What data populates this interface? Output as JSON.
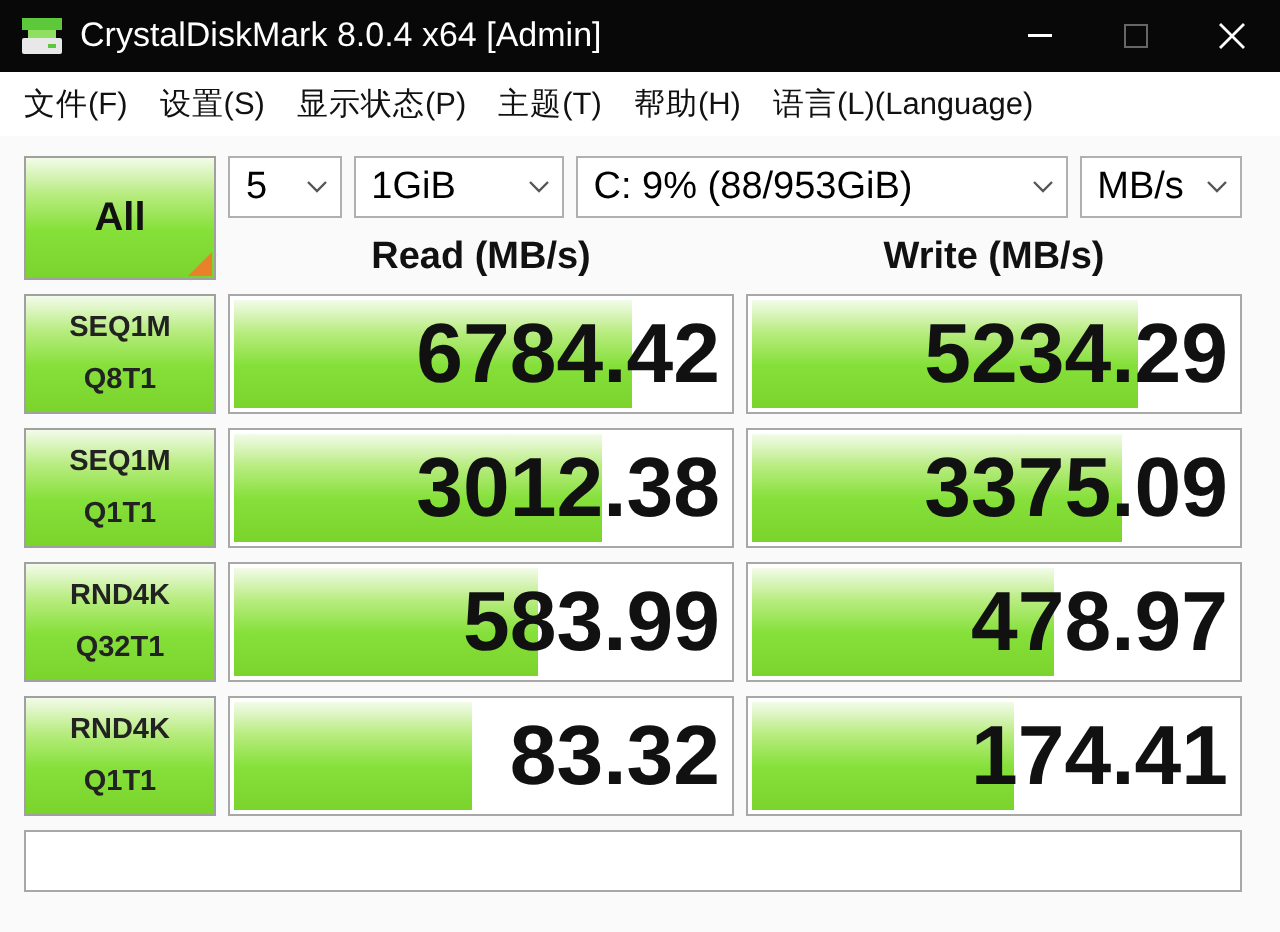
{
  "window": {
    "title": "CrystalDiskMark 8.0.4 x64 [Admin]"
  },
  "menu": [
    "文件(F)",
    "设置(S)",
    "显示状态(P)",
    "主题(T)",
    "帮助(H)",
    "语言(L)(Language)"
  ],
  "all_button": "All",
  "selectors": [
    {
      "kind": "count",
      "value": "5"
    },
    {
      "kind": "size",
      "value": "1GiB"
    },
    {
      "kind": "drive",
      "value": "C: 9% (88/953GiB)"
    },
    {
      "kind": "unit",
      "value": "MB/s"
    }
  ],
  "headers": {
    "read": "Read (MB/s)",
    "write": "Write (MB/s)"
  },
  "tests": [
    {
      "label": [
        "SEQ1M",
        "Q8T1"
      ],
      "read": {
        "value": "6784.42",
        "level": 0.81
      },
      "write": {
        "value": "5234.29",
        "level": 0.8
      }
    },
    {
      "label": [
        "SEQ1M",
        "Q1T1"
      ],
      "read": {
        "value": "3012.38",
        "level": 0.75
      },
      "write": {
        "value": "3375.09",
        "level": 0.77
      }
    },
    {
      "label": [
        "RND4K",
        "Q32T1"
      ],
      "read": {
        "value": "583.99",
        "level": 0.62
      },
      "write": {
        "value": "478.97",
        "level": 0.63
      }
    },
    {
      "label": [
        "RND4K",
        "Q1T1"
      ],
      "read": {
        "value": "83.32",
        "level": 0.49
      },
      "write": {
        "value": "174.41",
        "level": 0.55
      }
    }
  ]
}
